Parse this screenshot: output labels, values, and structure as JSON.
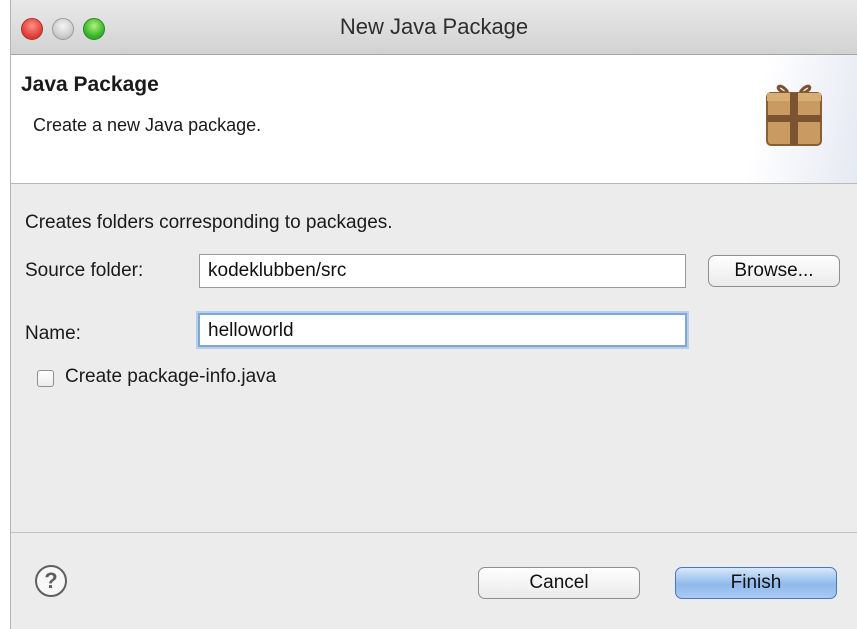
{
  "window": {
    "title": "New Java Package"
  },
  "banner": {
    "title": "Java Package",
    "description": "Create a new Java package.",
    "icon": "package-icon"
  },
  "form": {
    "intro": "Creates folders corresponding to packages.",
    "source_folder_label": "Source folder:",
    "source_folder_value": "kodeklubben/src",
    "browse_label": "Browse...",
    "name_label": "Name:",
    "name_value": "helloworld",
    "package_info_label": "Create package-info.java",
    "package_info_checked": false
  },
  "footer": {
    "help_glyph": "?",
    "cancel_label": "Cancel",
    "finish_label": "Finish"
  }
}
